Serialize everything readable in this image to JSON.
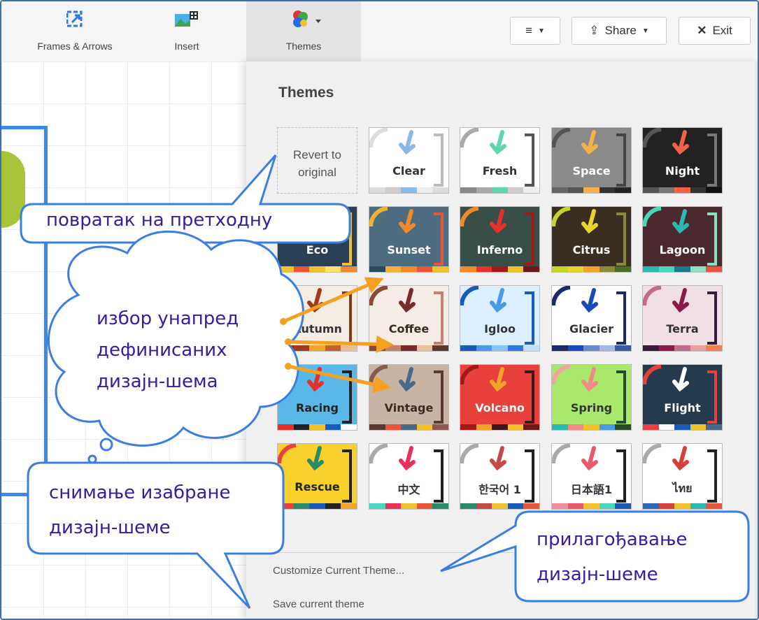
{
  "toolbar": {
    "items": [
      {
        "label": "Frames & Arrows"
      },
      {
        "label": "Insert"
      },
      {
        "label": "Themes"
      }
    ],
    "share_label": "Share",
    "exit_label": "Exit"
  },
  "panel": {
    "title": "Themes",
    "revert_label": "Revert to original",
    "customize_label": "Customize Current Theme...",
    "save_label": "Save current theme"
  },
  "themes": [
    {
      "name": "Clear",
      "bg": "#ffffff",
      "fg": "#333333",
      "arc": "#dddddd",
      "arrow": "#8ab8e8",
      "bracket": "#bbbbbb",
      "strip": [
        "#dddddd",
        "#cccccc",
        "#8ab8e8",
        "#eeeeee",
        "#dddddd"
      ]
    },
    {
      "name": "Fresh",
      "bg": "#ffffff",
      "fg": "#333333",
      "arc": "#aaaaaa",
      "arrow": "#5fd6b0",
      "bracket": "#555555",
      "strip": [
        "#888888",
        "#aaaaaa",
        "#5fd6b0",
        "#cccccc",
        "#eeeeee"
      ]
    },
    {
      "name": "Space",
      "bg": "#8a8a8a",
      "fg": "#ffffff",
      "arc": "#555555",
      "arrow": "#f5b04a",
      "bracket": "#444444",
      "strip": [
        "#666666",
        "#555555",
        "#f5b04a",
        "#333333",
        "#222222"
      ]
    },
    {
      "name": "Night",
      "bg": "#222222",
      "fg": "#ffffff",
      "arc": "#555555",
      "arrow": "#f2614a",
      "bracket": "#777777",
      "strip": [
        "#555555",
        "#777777",
        "#f2614a",
        "#333333",
        "#111111"
      ]
    },
    {
      "name": "Eco",
      "bg": "#2b4055",
      "fg": "#ffffff",
      "arc": "#f2c12e",
      "arrow": "#e8553a",
      "bracket": "#f2c12e",
      "strip": [
        "#f2c12e",
        "#e8553a",
        "#f2c12e",
        "#ffe16b",
        "#f08a3a"
      ]
    },
    {
      "name": "Sunset",
      "bg": "#4e6c80",
      "fg": "#ffffff",
      "arc": "#f2b135",
      "arrow": "#f08a2a",
      "bracket": "#e8553a",
      "strip": [
        "#2b4a5e",
        "#f2b135",
        "#f08a2a",
        "#e8553a",
        "#f2c12e"
      ]
    },
    {
      "name": "Inferno",
      "bg": "#3a4e48",
      "fg": "#ffffff",
      "arc": "#f08a2a",
      "arrow": "#e8302a",
      "bracket": "#a01a1a",
      "strip": [
        "#f08a2a",
        "#e8302a",
        "#a01a1a",
        "#f2c12e",
        "#6a1a1a"
      ]
    },
    {
      "name": "Citrus",
      "bg": "#3a2e22",
      "fg": "#ffffff",
      "arc": "#c4d62a",
      "arrow": "#e8d62a",
      "bracket": "#8a8a3a",
      "strip": [
        "#c4d62a",
        "#e8d62a",
        "#f2a42a",
        "#8a8a3a",
        "#4a6a2a"
      ]
    },
    {
      "name": "Lagoon",
      "bg": "#4a2a2e",
      "fg": "#ffffff",
      "arc": "#4ad6b8",
      "arrow": "#2ab8b0",
      "bracket": "#8ae0c0",
      "strip": [
        "#2ab8b0",
        "#4ad6b8",
        "#1a7a8a",
        "#8ae0c0",
        "#e8553a"
      ]
    },
    {
      "name": "Autumn",
      "bg": "#f5ece4",
      "fg": "#333333",
      "arc": "#7a3a1a",
      "arrow": "#a03a1a",
      "bracket": "#7a3a1a",
      "strip": [
        "#7a3a1a",
        "#a03a1a",
        "#f2a42a",
        "#c4602a",
        "#e8c08a"
      ]
    },
    {
      "name": "Coffee",
      "bg": "#f5ece6",
      "fg": "#3a2a22",
      "arc": "#8a4a3a",
      "arrow": "#7a2a2a",
      "bracket": "#c4806a",
      "strip": [
        "#8a4a3a",
        "#c4806a",
        "#7a2a2a",
        "#e8c0a0",
        "#5a3a2a"
      ]
    },
    {
      "name": "Igloo",
      "bg": "#dcefff",
      "fg": "#333333",
      "arc": "#1a5ab8",
      "arrow": "#4a9ae8",
      "bracket": "#1a5ab8",
      "strip": [
        "#1a5ab8",
        "#4a9ae8",
        "#8ac4f2",
        "#2a7ae0",
        "#c4e0f8"
      ]
    },
    {
      "name": "Glacier",
      "bg": "#ffffff",
      "fg": "#333333",
      "arc": "#1a2a6a",
      "arrow": "#1a4ab8",
      "bracket": "#1a2a6a",
      "strip": [
        "#1a2a6a",
        "#1a4ab8",
        "#6a8ad6",
        "#a4b8e8",
        "#3a5aa0"
      ]
    },
    {
      "name": "Terra",
      "bg": "#f0e0e6",
      "fg": "#333333",
      "arc": "#c46a8a",
      "arrow": "#8a1a4a",
      "bracket": "#3a1a3a",
      "strip": [
        "#3a1a3a",
        "#8a1a4a",
        "#c46a8a",
        "#e8a0a0",
        "#f2804a"
      ]
    },
    {
      "name": "Racing",
      "bg": "#5ab8e8",
      "fg": "#222222",
      "arc": "#e8302a",
      "arrow": "#e8302a",
      "bracket": "#222222",
      "strip": [
        "#e8302a",
        "#222222",
        "#f2c12e",
        "#1a5ab8",
        "#ffffff"
      ]
    },
    {
      "name": "Vintage",
      "bg": "#c8b4a4",
      "fg": "#3a2a22",
      "arc": "#8a5a4a",
      "arrow": "#4a6a8a",
      "bracket": "#5a3a2a",
      "strip": [
        "#5a3a2a",
        "#e8553a",
        "#4a6a8a",
        "#f2c12e",
        "#8a5a4a"
      ]
    },
    {
      "name": "Volcano",
      "bg": "#e8403a",
      "fg": "#ffffff",
      "arc": "#a01a1a",
      "arrow": "#f2a42a",
      "bracket": "#3a1a1a",
      "strip": [
        "#a01a1a",
        "#f2a42a",
        "#3a1a1a",
        "#f2c12e",
        "#6a1a1a"
      ]
    },
    {
      "name": "Spring",
      "bg": "#a8e86a",
      "fg": "#333333",
      "arc": "#f2a4a0",
      "arrow": "#f28a8a",
      "bracket": "#2a4a2a",
      "strip": [
        "#2ab8b0",
        "#f28a8a",
        "#f2c12e",
        "#4a9ae8",
        "#2a4a2a"
      ]
    },
    {
      "name": "Flight",
      "bg": "#263a4e",
      "fg": "#ffffff",
      "arc": "#e8403a",
      "arrow": "#ffffff",
      "bracket": "#e8403a",
      "strip": [
        "#e8403a",
        "#ffffff",
        "#1a5ab8",
        "#f2c12e",
        "#4a6a8a"
      ]
    },
    {
      "name": "Rescue",
      "bg": "#f8d22a",
      "fg": "#222222",
      "arc": "#e8403a",
      "arrow": "#2a8a6a",
      "bracket": "#222222",
      "strip": [
        "#e8403a",
        "#2a8a6a",
        "#1a5ab8",
        "#222222",
        "#f2a42a"
      ]
    },
    {
      "name": "中文",
      "bg": "#ffffff",
      "fg": "#333333",
      "arc": "#aaaaaa",
      "arrow": "#e8305a",
      "bracket": "#222222",
      "strip": [
        "#4ad6c0",
        "#e8305a",
        "#f2c12e",
        "#e8553a",
        "#2a8a6a"
      ]
    },
    {
      "name": "한국어 1",
      "bg": "#ffffff",
      "fg": "#333333",
      "arc": "#aaaaaa",
      "arrow": "#c44a4a",
      "bracket": "#222222",
      "strip": [
        "#2a8a6a",
        "#c44a4a",
        "#f2c12e",
        "#1a5ab8",
        "#e8553a"
      ]
    },
    {
      "name": "日本語1",
      "bg": "#ffffff",
      "fg": "#333333",
      "arc": "#aaaaaa",
      "arrow": "#e85a6a",
      "bracket": "#222222",
      "strip": [
        "#f28aa0",
        "#e85a6a",
        "#f2c12e",
        "#4ad6c0",
        "#1a5ab8"
      ]
    },
    {
      "name": "ไทย",
      "bg": "#ffffff",
      "fg": "#333333",
      "arc": "#aaaaaa",
      "arrow": "#d6403a",
      "bracket": "#222222",
      "strip": [
        "#2a6ab8",
        "#d6403a",
        "#f2c12e",
        "#2ab8b0",
        "#e8553a"
      ]
    }
  ],
  "callouts": {
    "revert": "повратак на претходну",
    "predefined": [
      "избор унапред",
      "дефинисаних",
      "дизајн-шема"
    ],
    "save": [
      "снимање изабране",
      "дизајн-шеме"
    ],
    "customize": [
      "прилагођавање",
      "дизајн-шеме"
    ]
  },
  "colors": {
    "callout_border": "#3a7fe0",
    "callout_text": "#3a1aa0",
    "arrow_orange": "#f5a020",
    "frame_blue": "#3a6fb5"
  }
}
